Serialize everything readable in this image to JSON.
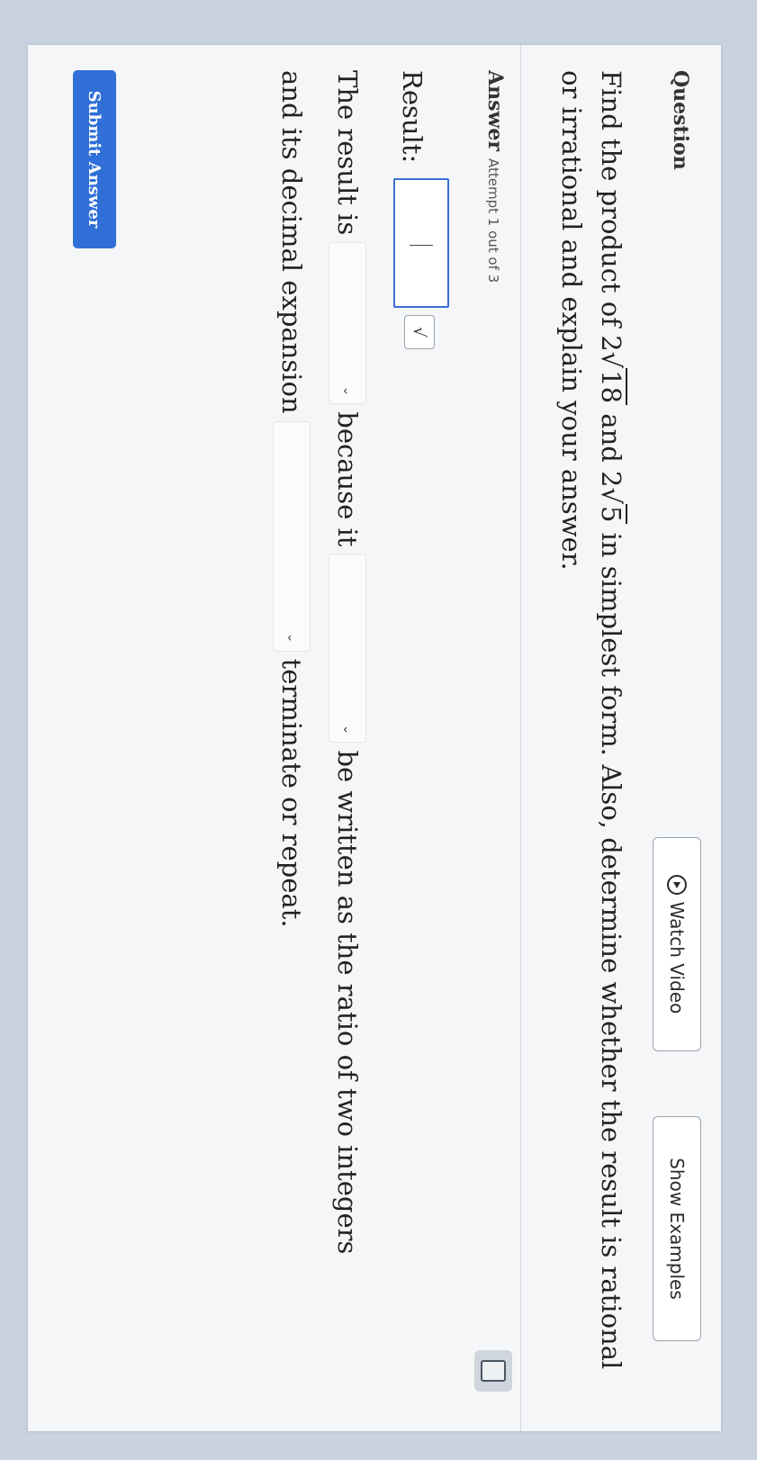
{
  "question": {
    "heading": "Question",
    "watch_video": "Watch Video",
    "show_examples": "Show Examples",
    "text_part1": "Find the product of 2",
    "radicand1": "18",
    "text_part2": " and 2",
    "radicand2": "5",
    "text_part3": " in simplest form. Also, determine whether the result is rational or irrational and explain your answer."
  },
  "answer": {
    "heading": "Answer",
    "attempt": "Attempt 1 out of 3",
    "result_label": "Result:",
    "result_value": "",
    "sqrt_symbol": "√",
    "line1_start": "The result is",
    "line1_mid": "because it",
    "line1_end": "be written as the ratio of two integers",
    "line2_start": "and its decimal expansion",
    "line2_end": "terminate or repeat.",
    "dropdown1_value": "",
    "dropdown2_value": "",
    "dropdown3_value": "",
    "chevron": "⌄"
  },
  "submit": "Submit Answer"
}
